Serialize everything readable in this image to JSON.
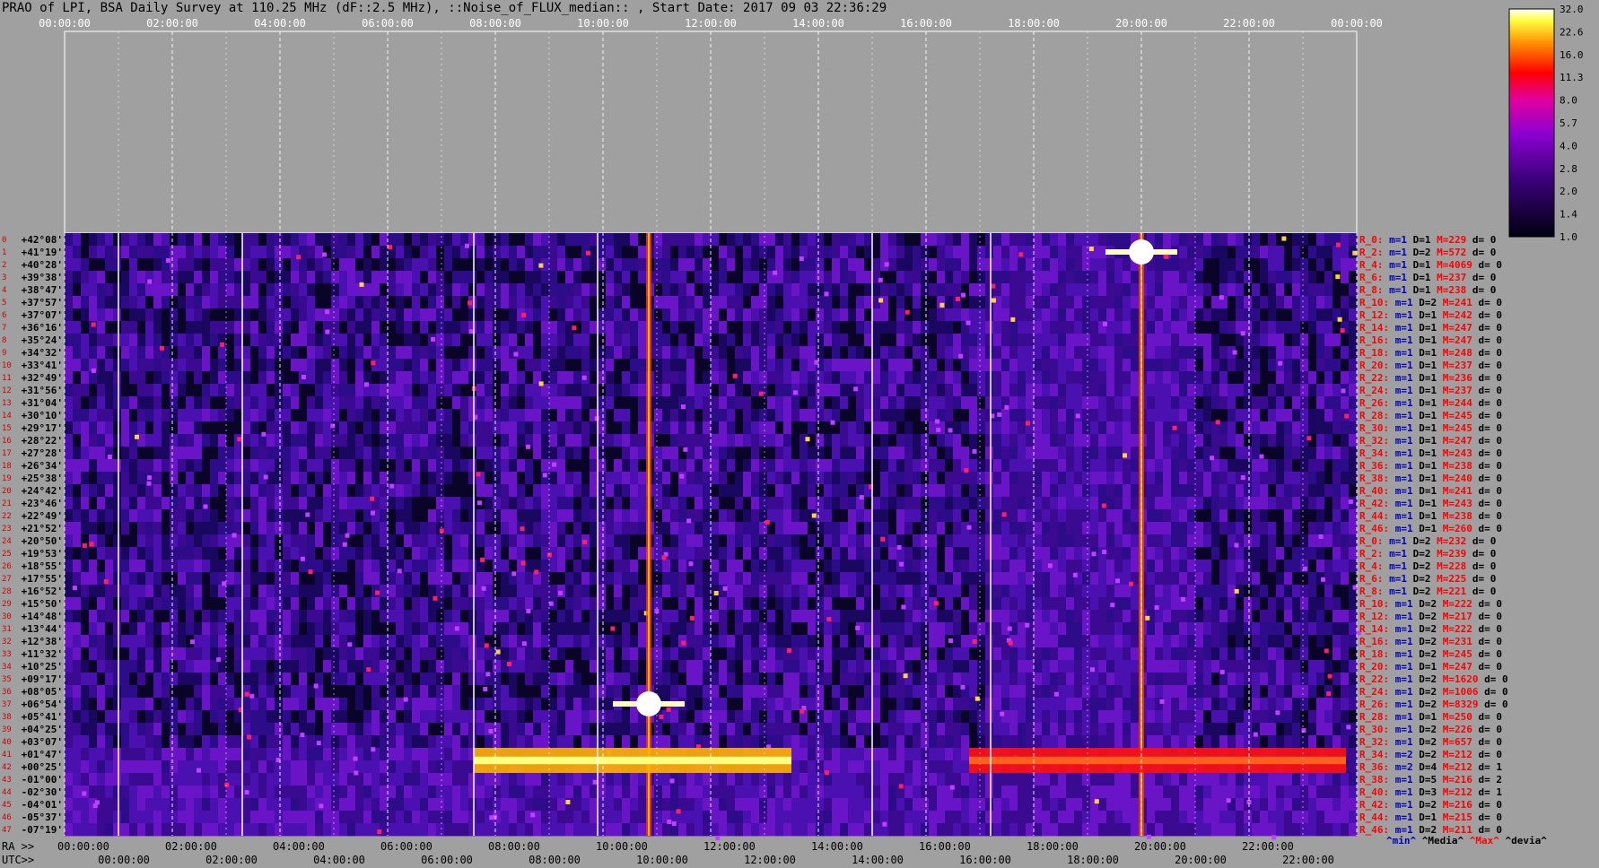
{
  "title": "PRAO of LPI, BSA Daily Survey at 110.25 MHz (dF::2.5 MHz), ::Noise_of_FLUX_median:: , Start Date: 2017 09 03 22:36:29",
  "chart_data": {
    "type": "heatmap",
    "title": "PRAO of LPI, BSA Daily Survey at 110.25 MHz (dF::2.5 MHz), ::Noise_of_FLUX_median:: , Start Date: 2017 09 03 22:36:29",
    "top_ticks": [
      "00:00:00",
      "02:00:00",
      "04:00:00",
      "06:00:00",
      "08:00:00",
      "10:00:00",
      "12:00:00",
      "14:00:00",
      "16:00:00",
      "18:00:00",
      "20:00:00",
      "22:00:00",
      "00:00:00"
    ],
    "ra_prefix": "RA >>",
    "ra_ticks": [
      "00:00:00",
      "02:00:00",
      "04:00:00",
      "06:00:00",
      "08:00:00",
      "10:00:00",
      "12:00:00",
      "14:00:00",
      "16:00:00",
      "18:00:00",
      "20:00:00",
      "22:00:00"
    ],
    "utc_prefix": "UTC>>",
    "utc_ticks": [
      "00:00:00",
      "02:00:00",
      "04:00:00",
      "06:00:00",
      "08:00:00",
      "10:00:00",
      "12:00:00",
      "14:00:00",
      "16:00:00",
      "18:00:00",
      "20:00:00",
      "22:00:00"
    ],
    "declinations": [
      "+42°08'",
      "+41°19'",
      "+40°28'",
      "+39°38'",
      "+38°47'",
      "+37°57'",
      "+37°07'",
      "+36°16'",
      "+35°24'",
      "+34°32'",
      "+33°41'",
      "+32°49'",
      "+31°56'",
      "+31°04'",
      "+30°10'",
      "+29°17'",
      "+28°22'",
      "+27°28'",
      "+26°34'",
      "+25°38'",
      "+24°42'",
      "+23°46'",
      "+22°49'",
      "+21°52'",
      "+20°50'",
      "+19°53'",
      "+18°55'",
      "+17°55'",
      "+16°52'",
      "+15°50'",
      "+14°48'",
      "+13°44'",
      "+12°38'",
      "+11°32'",
      "+10°25'",
      "+09°17'",
      "+08°05'",
      "+06°54'",
      "+05°41'",
      "+04°25'",
      "+03°07'",
      "+01°47'",
      "+00°25'",
      "-01°00'",
      "-02°30'",
      "-04°01'",
      "-05°37'",
      "-07°19'"
    ],
    "row_indices": [
      "0",
      "1",
      "2",
      "3",
      "4",
      "5",
      "6",
      "7",
      "8",
      "9",
      "10",
      "11",
      "12",
      "13",
      "14",
      "15",
      "16",
      "17",
      "18",
      "19",
      "20",
      "21",
      "22",
      "23",
      "24",
      "25",
      "26",
      "27",
      "28",
      "29",
      "30",
      "31",
      "32",
      "33",
      "34",
      "35",
      "36",
      "37",
      "38",
      "39",
      "40",
      "41",
      "42",
      "43",
      "44",
      "45",
      "46",
      "47"
    ],
    "right_labels": [
      "R_0: m=1 D=1 M=229 d= 0",
      "R_2: m=1 D=2 M=572 d= 0",
      "R_4: m=1 D=1 M=4069 d= 0",
      "R_6: m=1 D=1 M=237 d= 0",
      "R_8: m=1 D=1 M=238 d= 0",
      "R_10: m=1 D=2 M=241 d= 0",
      "R_12: m=1 D=1 M=242 d= 0",
      "R_14: m=1 D=1 M=247 d= 0",
      "R_16: m=1 D=1 M=247 d= 0",
      "R_18: m=1 D=1 M=248 d= 0",
      "R_20: m=1 D=1 M=237 d= 0",
      "R_22: m=1 D=1 M=236 d= 0",
      "R_24: m=1 D=1 M=237 d= 0",
      "R_26: m=1 D=1 M=244 d= 0",
      "R_28: m=1 D=1 M=245 d= 0",
      "R_30: m=1 D=1 M=245 d= 0",
      "R_32: m=1 D=1 M=247 d= 0",
      "R_34: m=1 D=1 M=243 d= 0",
      "R_36: m=1 D=1 M=238 d= 0",
      "R_38: m=1 D=1 M=240 d= 0",
      "R_40: m=1 D=1 M=241 d= 0",
      "R_42: m=1 D=1 M=243 d= 0",
      "R_44: m=1 D=1 M=238 d= 0",
      "R_46: m=1 D=1 M=260 d= 0",
      "R_0: m=1 D=2 M=232 d= 0",
      "R_2: m=1 D=2 M=239 d= 0",
      "R_4: m=1 D=2 M=228 d= 0",
      "R_6: m=1 D=2 M=225 d= 0",
      "R_8: m=1 D=2 M=221 d= 0",
      "R_10: m=1 D=2 M=222 d= 0",
      "R_12: m=1 D=2 M=217 d= 0",
      "R_14: m=1 D=2 M=222 d= 0",
      "R_16: m=1 D=2 M=231 d= 0",
      "R_18: m=1 D=2 M=245 d= 0",
      "R_20: m=1 D=1 M=247 d= 0",
      "R_22: m=1 D=2 M=1620 d= 0",
      "R_24: m=1 D=2 M=1006 d= 0",
      "R_26: m=1 D=2 M=8329 d= 0",
      "R_28: m=1 D=1 M=250 d= 0",
      "R_30: m=1 D=2 M=226 d= 0",
      "R_32: m=1 D=2 M=657 d= 0",
      "R_34: m=2 D=2 M=212 d= 0",
      "R_36: m=2 D=4 M=212 d= 1",
      "R_38: m=1 D=5 M=216 d= 2",
      "R_40: m=1 D=3 M=212 d= 1",
      "R_42: m=1 D=2 M=216 d= 0",
      "R_44: m=1 D=1 M=215 d= 0",
      "R_46: m=1 D=2 M=211 d= 0"
    ],
    "colorbar_ticks": [
      "32.0",
      "22.6",
      "16.0",
      "11.3",
      "8.0",
      "5.7",
      "4.0",
      "2.8",
      "2.0",
      "1.4",
      "1.0"
    ],
    "legend": {
      "min": "^min^",
      "median": "^Media^",
      "max": "^Max^",
      "deviation": "^devia^"
    },
    "colors": {
      "min": "#0000c0",
      "median": "#000000",
      "max": "#ff0000",
      "background": "#a0a0a0"
    },
    "features": [
      {
        "name": "source-10h50",
        "ra_hours": 10.85,
        "dec_row": 37.5,
        "value": 32
      },
      {
        "name": "source-20h00",
        "ra_hours": 20.0,
        "dec_row": 1.5,
        "value": 32
      },
      {
        "name": "galactic-band",
        "ra_from": 7.6,
        "ra_to": 13.5,
        "dec_row_from": 41,
        "dec_row_to": 43,
        "value": 16
      },
      {
        "name": "band-east",
        "ra_from": 16.8,
        "ra_to": 23.8,
        "dec_row_from": 41,
        "dec_row_to": 43,
        "value": 8
      }
    ]
  }
}
